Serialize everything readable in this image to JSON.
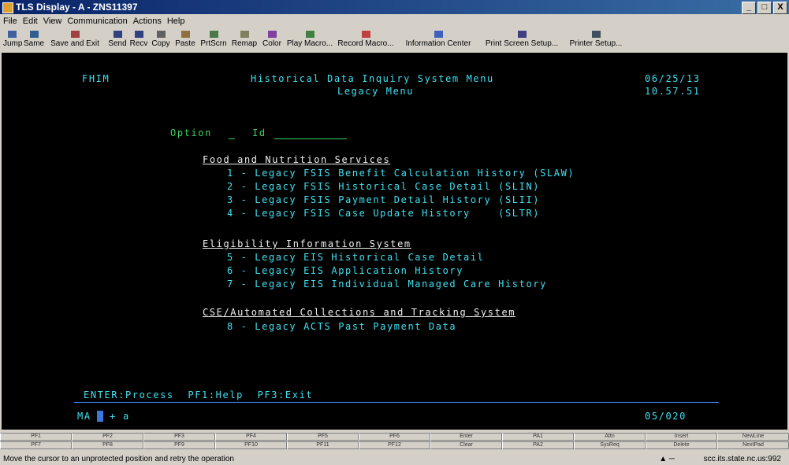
{
  "window": {
    "title": "TLS Display - A - ZNS11397",
    "controls": [
      "_",
      "□",
      "X"
    ]
  },
  "menu": [
    "File",
    "Edit",
    "View",
    "Communication",
    "Actions",
    "Help"
  ],
  "toolbar": [
    {
      "label": "Jump",
      "icon": "jump-icon",
      "color": "#4060a0"
    },
    {
      "label": "Same",
      "icon": "same-icon",
      "color": "#306090"
    },
    {
      "label": "Save and Exit",
      "icon": "save-exit-icon",
      "color": "#a04040"
    },
    {
      "label": "Send",
      "icon": "send-icon",
      "color": "#304080"
    },
    {
      "label": "Recv",
      "icon": "recv-icon",
      "color": "#304080"
    },
    {
      "label": "Copy",
      "icon": "copy-icon",
      "color": "#606060"
    },
    {
      "label": "Paste",
      "icon": "paste-icon",
      "color": "#907040"
    },
    {
      "label": "PrtScrn",
      "icon": "print-screen-icon",
      "color": "#4a7a4a"
    },
    {
      "label": "Remap",
      "icon": "remap-icon",
      "color": "#808060"
    },
    {
      "label": "Color",
      "icon": "color-icon",
      "color": "#8040a0"
    },
    {
      "label": "Play Macro...",
      "icon": "play-macro-icon",
      "color": "#408040"
    },
    {
      "label": "Record Macro...",
      "icon": "record-macro-icon",
      "color": "#c04040"
    },
    {
      "label": "Information Center",
      "icon": "info-icon",
      "color": "#4060c0"
    },
    {
      "label": "Print Screen Setup...",
      "icon": "print-setup-icon",
      "color": "#404080"
    },
    {
      "label": "Printer Setup...",
      "icon": "printer-icon",
      "color": "#405060"
    }
  ],
  "terminal": {
    "system_id": "FHIM",
    "menu_title": "Historical Data Inquiry System Menu",
    "sub_title": "Legacy Menu",
    "date": "06/25/13",
    "time": "10.57.51",
    "option_label": "Option",
    "option_value": "",
    "id_label": "Id",
    "id_value": "",
    "sections": [
      {
        "heading": "Food and Nutrition Services",
        "items": [
          "1 - Legacy FSIS Benefit Calculation History (SLAW)",
          "2 - Legacy FSIS Historical Case Detail (SLIN)",
          "3 - Legacy FSIS Payment Detail History (SLII)",
          "4 - Legacy FSIS Case Update History    (SLTR)"
        ]
      },
      {
        "heading": "Eligibility Information System",
        "items": [
          "5 - Legacy EIS Historical Case Detail",
          "6 - Legacy EIS Application History",
          "7 - Legacy EIS Individual Managed Care History"
        ]
      },
      {
        "heading": "CSE/Automated Collections and Tracking System",
        "items": [
          "8 - Legacy ACTS Past Payment Data"
        ]
      }
    ],
    "fkeys": "ENTER:Process  PF1:Help  PF3:Exit",
    "oia_left": "MA",
    "oia_plus": "+",
    "oia_a": "a",
    "cursor_pos": "05/020"
  },
  "pf_row1": [
    "PF1",
    "PF2",
    "PF3",
    "PF4",
    "PF5",
    "PF6",
    "Enter",
    "PA1",
    "Attn",
    "Insert",
    "NewLine"
  ],
  "pf_row2": [
    "PF7",
    "PF8",
    "PF9",
    "PF10",
    "PF11",
    "PF12",
    "Clear",
    "PA2",
    "SysReq",
    "Delete",
    "NextPad"
  ],
  "status": {
    "message": "Move the cursor to an unprotected position and retry the operation",
    "host": "scc.its.state.nc.us:992"
  }
}
